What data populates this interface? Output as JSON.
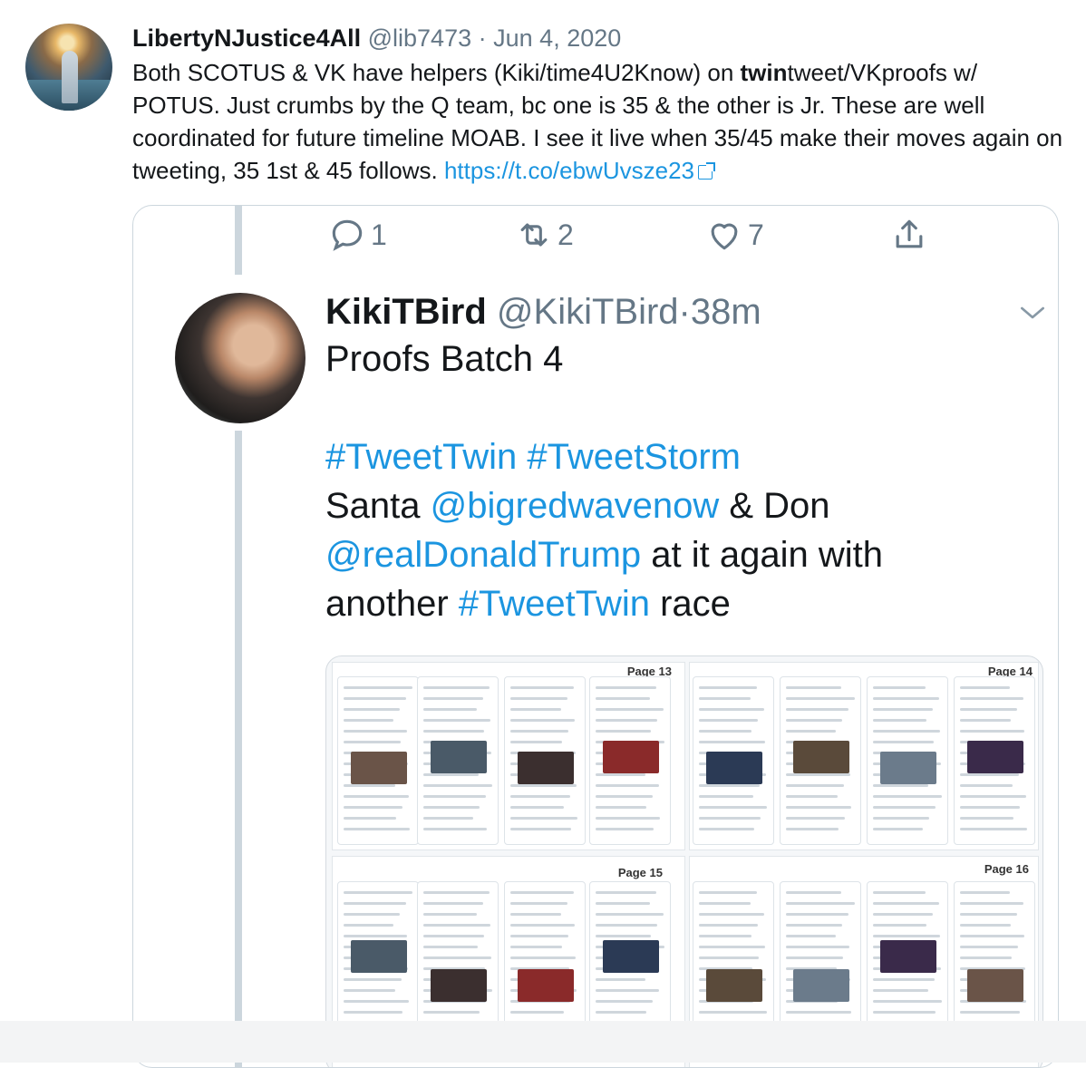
{
  "tweet": {
    "author_name": "LibertyNJustice4All",
    "author_handle": "@lib7473",
    "separator": "·",
    "date": "Jun 4, 2020",
    "text_part1": "Both SCOTUS & VK have helpers (Kiki/time4U2Know) on ",
    "text_bold": "twin",
    "text_part2": "tweet/VKproofs w/ POTUS. Just crumbs by the Q team, bc one is 35 & the other is Jr. These are well coordinated for future timeline MOAB. I see it live when 35/45 make their moves again on tweeting, 35 1st & 45 follows. ",
    "link": "https://t.co/ebwUvsze23"
  },
  "embedded": {
    "actions": {
      "reply_count": "1",
      "retweet_count": "2",
      "like_count": "7"
    },
    "author_name": "KikiTBird",
    "author_handle": "@KikiTBird",
    "separator": "·",
    "time": "38m",
    "line1": "Proofs Batch 4",
    "tag_tweettwin": "#TweetTwin",
    "tag_tweetstorm": "#TweetStorm",
    "santa": "Santa ",
    "mention_bigredwave": "@bigredwavenow",
    "and_don": " & Don",
    "mention_trump": "@realDonaldTrump",
    "at_it_again": " at it again with",
    "another": "another ",
    "race": " race",
    "collage_pages": [
      "Page 13",
      "Page 14",
      "Page 15",
      "Page 16"
    ]
  },
  "icons": [
    "reply-icon",
    "retweet-icon",
    "like-icon",
    "share-icon",
    "chevron-down-icon",
    "external-link-icon"
  ],
  "colors": {
    "link": "#1b95e0",
    "secondary": "#657786",
    "border": "#ccd6dd"
  }
}
